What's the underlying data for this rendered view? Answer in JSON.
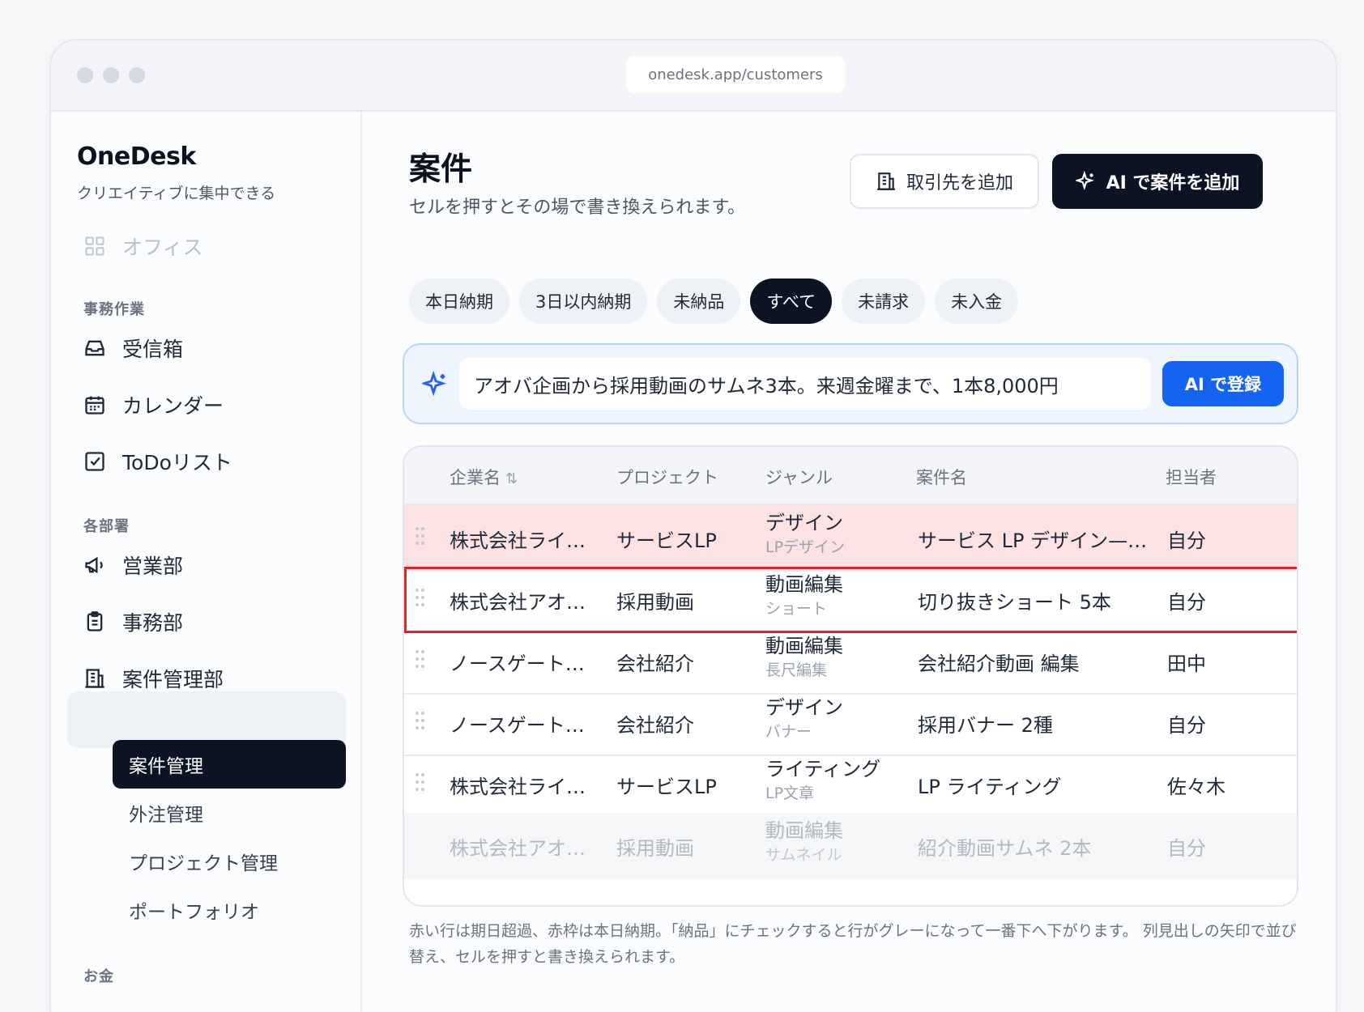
{
  "browser": {
    "url": "onedesk.app/customers"
  },
  "sidebar": {
    "brand": "OneDesk",
    "tagline": "クリエイティブに集中できる",
    "office": "オフィス",
    "section_office_work": "事務作業",
    "inbox": "受信箱",
    "calendar": "カレンダー",
    "todo": "ToDoリスト",
    "section_departments": "各部署",
    "sales": "営業部",
    "admin": "事務部",
    "projects_dept": "案件管理部",
    "sub_items": [
      "案件管理",
      "外注管理",
      "プロジェクト管理",
      "ポートフォリオ"
    ],
    "section_money": "お金"
  },
  "header": {
    "title": "案件",
    "subtitle": "セルを押すとその場で書き換えられます。",
    "add_client_label": "取引先を追加",
    "ai_add_label": "AI で案件を追加"
  },
  "filters": [
    "本日納期",
    "3日以内納期",
    "未納品",
    "すべて",
    "未請求",
    "未入金"
  ],
  "filters_active": "すべて",
  "ai_bar": {
    "input_value": "アオバ企画から採用動画のサムネ3本。来週金曜まで、1本8,000円",
    "button_label": "AI で登録"
  },
  "table": {
    "columns": {
      "company": "企業名",
      "sort_icon": "⇅",
      "project": "プロジェクト",
      "genre": "ジャンル",
      "name": "案件名",
      "owner": "担当者"
    },
    "rows": [
      {
        "company": "株式会社ライ…",
        "project": "サービスLP",
        "genre": "デザイン",
        "genre_sub": "LPデザイン",
        "name": "サービス LP デザイン—…",
        "owner": "自分",
        "state": "overdue"
      },
      {
        "company": "株式会社アオ…",
        "project": "採用動画",
        "genre": "動画編集",
        "genre_sub": "ショート",
        "name": "切り抜きショート 5本",
        "owner": "自分",
        "state": "today"
      },
      {
        "company": "ノースゲート…",
        "project": "会社紹介",
        "genre": "動画編集",
        "genre_sub": "長尺編集",
        "name": "会社紹介動画 編集",
        "owner": "田中",
        "state": "normal"
      },
      {
        "company": "ノースゲート…",
        "project": "会社紹介",
        "genre": "デザイン",
        "genre_sub": "バナー",
        "name": "採用バナー 2種",
        "owner": "自分",
        "state": "normal"
      },
      {
        "company": "株式会社ライ…",
        "project": "サービスLP",
        "genre": "ライティング",
        "genre_sub": "LP文章",
        "name": "LP ライティング",
        "owner": "佐々木",
        "state": "normal"
      },
      {
        "company": "株式会社アオ…",
        "project": "採用動画",
        "genre": "動画編集",
        "genre_sub": "サムネイル",
        "name": "紹介動画サムネ 2本",
        "owner": "自分",
        "state": "done"
      }
    ]
  },
  "footnote": "赤い行は期日超過、赤枠は本日納期。「納品」にチェックすると行がグレーになって一番下へ下がります。 列見出しの矢印で並び替え、セルを押すと書き換えられます。",
  "colors": {
    "primary_dark": "#0c1424",
    "accent_blue": "#1463f3",
    "overdue_bg": "#fde2e4",
    "today_border": "#dc2626"
  }
}
